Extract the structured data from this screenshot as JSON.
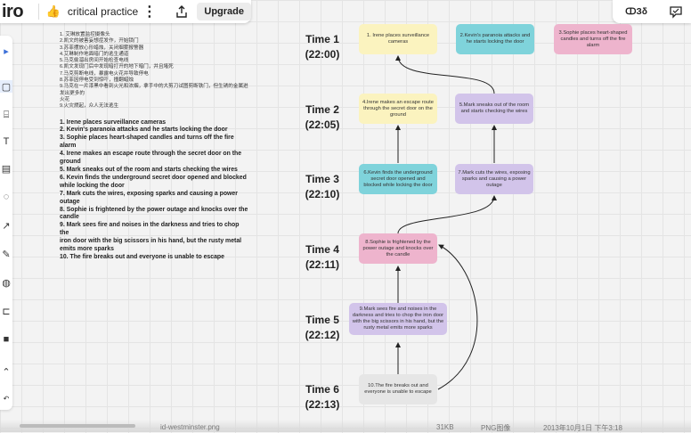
{
  "app": {
    "logo": "iro",
    "board_title": "critical practice",
    "upgrade_label": "Upgrade",
    "top_right_text": "ↀЗδ"
  },
  "notes": {
    "cn_lines": [
      "1. 艾琳放置监控摄像头",
      "2.凯文的被害妄想症发作，开始锁门",
      "3.苏菲摆放心形蜡烛，关闭烟雾报警器",
      "4.艾琳制作地面暗门的逃生通道",
      "5.马克偷溜出房间开始检查电线",
      "6.凯文发现门后中发现暗打开的地下暗门，并且堵死",
      "7.马克剪断电线，暴露电火花并导致停电",
      "8.苏菲因停电受到惊吓，撞翻蜡烛",
      "9.马克在一片漆黑中看到火光和浓烟，拿手中的大剪刀试图剪断铁门，但生锈的金属迸发出更多的",
      "火花",
      "9.火灾燃起，众人无法逃生"
    ],
    "en_lines": [
      "1. Irene places surveillance cameras",
      "2. Kevin's paranoia attacks and he starts locking the door",
      "3. Sophie places heart-shaped candles and turns off the fire",
      "alarm",
      "4. Irene makes an escape route through the secret door on the",
      "ground",
      "5. Mark sneaks out of the room and starts checking the wires",
      "6. Kevin finds the underground secret door opened and blocked",
      "while locking the door",
      "7. Mark cuts the wires, exposing sparks and causing a power",
      "outage",
      "8. Sophie is frightened by the power outage and knocks over the",
      "candle",
      "9. Mark sees fire and noises in the darkness and tries to chop the",
      "iron door with the big scissors in his hand, but the rusty metal",
      "emits more sparks",
      "10. The fire breaks out and everyone is unable to escape"
    ]
  },
  "timeline": [
    {
      "label": "Time 1",
      "time": "(22:00)"
    },
    {
      "label": "Time 2",
      "time": "(22:05)"
    },
    {
      "label": "Time 3",
      "time": "(22:10)"
    },
    {
      "label": "Time 4",
      "time": "(22:11)"
    },
    {
      "label": "Time 5",
      "time": "(22:12)"
    },
    {
      "label": "Time 6",
      "time": "(22:13)"
    }
  ],
  "cards": [
    {
      "text": "1. Irene places surveillance cameras",
      "color": "#fbf3bf"
    },
    {
      "text": "2.Kevin's paranoia attacks and he starts locking the door",
      "color": "#7fd3db"
    },
    {
      "text": "3.Sophie places heart-shaped candles and turns off the fire alarm",
      "color": "#eeb4cd"
    },
    {
      "text": "4.Irene makes an escape route through the secret door on the ground",
      "color": "#fbf3bf"
    },
    {
      "text": "5.Mark sneaks out of the room and starts checking the wires",
      "color": "#d2c4ea"
    },
    {
      "text": "6.Kevin finds the underground secret door opened and blocked while locking the door",
      "color": "#7fd3db"
    },
    {
      "text": "7.Mark cuts the wires, exposing sparks and causing a power outage",
      "color": "#d2c4ea"
    },
    {
      "text": "8.Sophie is frightened by the power outage and knocks over the candle",
      "color": "#eeb4cd"
    },
    {
      "text": "9.Mark sees fire and noises in the darkness and tries to chop the iron door with the big scissors in his hand, but the rusty metal emits more sparks",
      "color": "#d2c4ea"
    },
    {
      "text": "10.The fire breaks out and everyone is unable to escape",
      "color": "#e6e6e6"
    }
  ],
  "bottom": {
    "left_text": "id-westminster.png",
    "right_text_1": "31KB",
    "right_text_2": "PNG图像",
    "right_text_3": "2013年10月1日 下午3:18"
  }
}
